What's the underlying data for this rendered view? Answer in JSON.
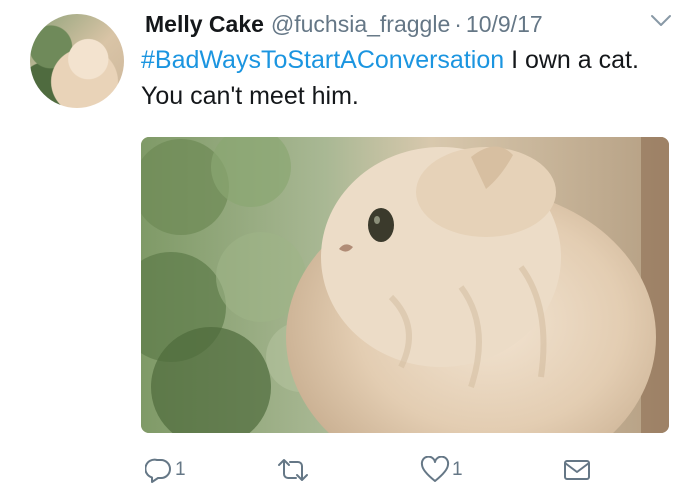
{
  "tweet": {
    "author_name": "Melly Cake",
    "handle": "@fuchsia_fraggle",
    "separator": "·",
    "date": "10/9/17",
    "hashtag": "#BadWaysToStartAConversation",
    "body": " I own a cat. You can't meet him."
  },
  "actions": {
    "reply_count": "1",
    "like_count": "1"
  },
  "icons": {
    "caret": "chevron-down-icon",
    "reply": "reply-icon",
    "retweet": "retweet-icon",
    "like": "heart-icon",
    "dm": "envelope-icon"
  },
  "colors": {
    "link": "#1b95e0",
    "muted": "#657786",
    "text": "#14171a"
  }
}
